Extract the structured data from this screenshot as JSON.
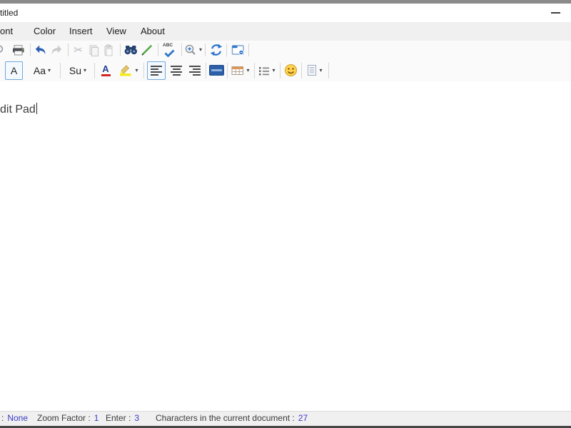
{
  "window": {
    "title": "titled",
    "controls": [
      "minimize-icon"
    ]
  },
  "menubar": {
    "items": [
      "ont",
      "Color",
      "Insert",
      "View",
      "About"
    ]
  },
  "toolbar_main": {
    "spell_label": "ABC",
    "icons": [
      "print-preview-icon",
      "print-icon",
      "undo-icon",
      "redo-icon",
      "cut-icon",
      "copy-icon",
      "paste-icon",
      "find-icon",
      "pen-icon",
      "spell-check-icon",
      "zoom-icon",
      "refresh-icon",
      "new-window-icon"
    ]
  },
  "toolbar_format": {
    "font_label": "A",
    "case_label": "Aa",
    "su_label": "Su",
    "color_label": "A",
    "dropdown_glyph": "▾",
    "icons": [
      "font-color-icon",
      "highlighter-icon",
      "align-left-icon",
      "align-center-icon",
      "align-right-icon",
      "panel-icon",
      "table-icon",
      "list-icon",
      "smiley-icon",
      "page-icon"
    ]
  },
  "editor": {
    "text": "dit Pad"
  },
  "statusbar": {
    "items": [
      {
        "label": ":",
        "value": "None"
      },
      {
        "label": "Zoom Factor :",
        "value": "1"
      },
      {
        "label": "Enter :",
        "value": "3"
      },
      {
        "label": "Characters in the current document :",
        "value": "27"
      }
    ]
  },
  "colors": {
    "accent_blue": "#2e75cc",
    "checked_border": "#6fa8dc",
    "status_value_blue": "#3a3ac9",
    "highlight_yellow": "#f4ea1e",
    "underline_red": "#d42525",
    "pen_green": "#57a84b",
    "smiley_yellow": "#ffd34d",
    "table_orange": "#e2944e",
    "menubar_bg": "#f0f0f0",
    "toolbar_bg": "#fafafa",
    "top_strip": "#8a8a8a",
    "bottom_strip": "#474747"
  }
}
